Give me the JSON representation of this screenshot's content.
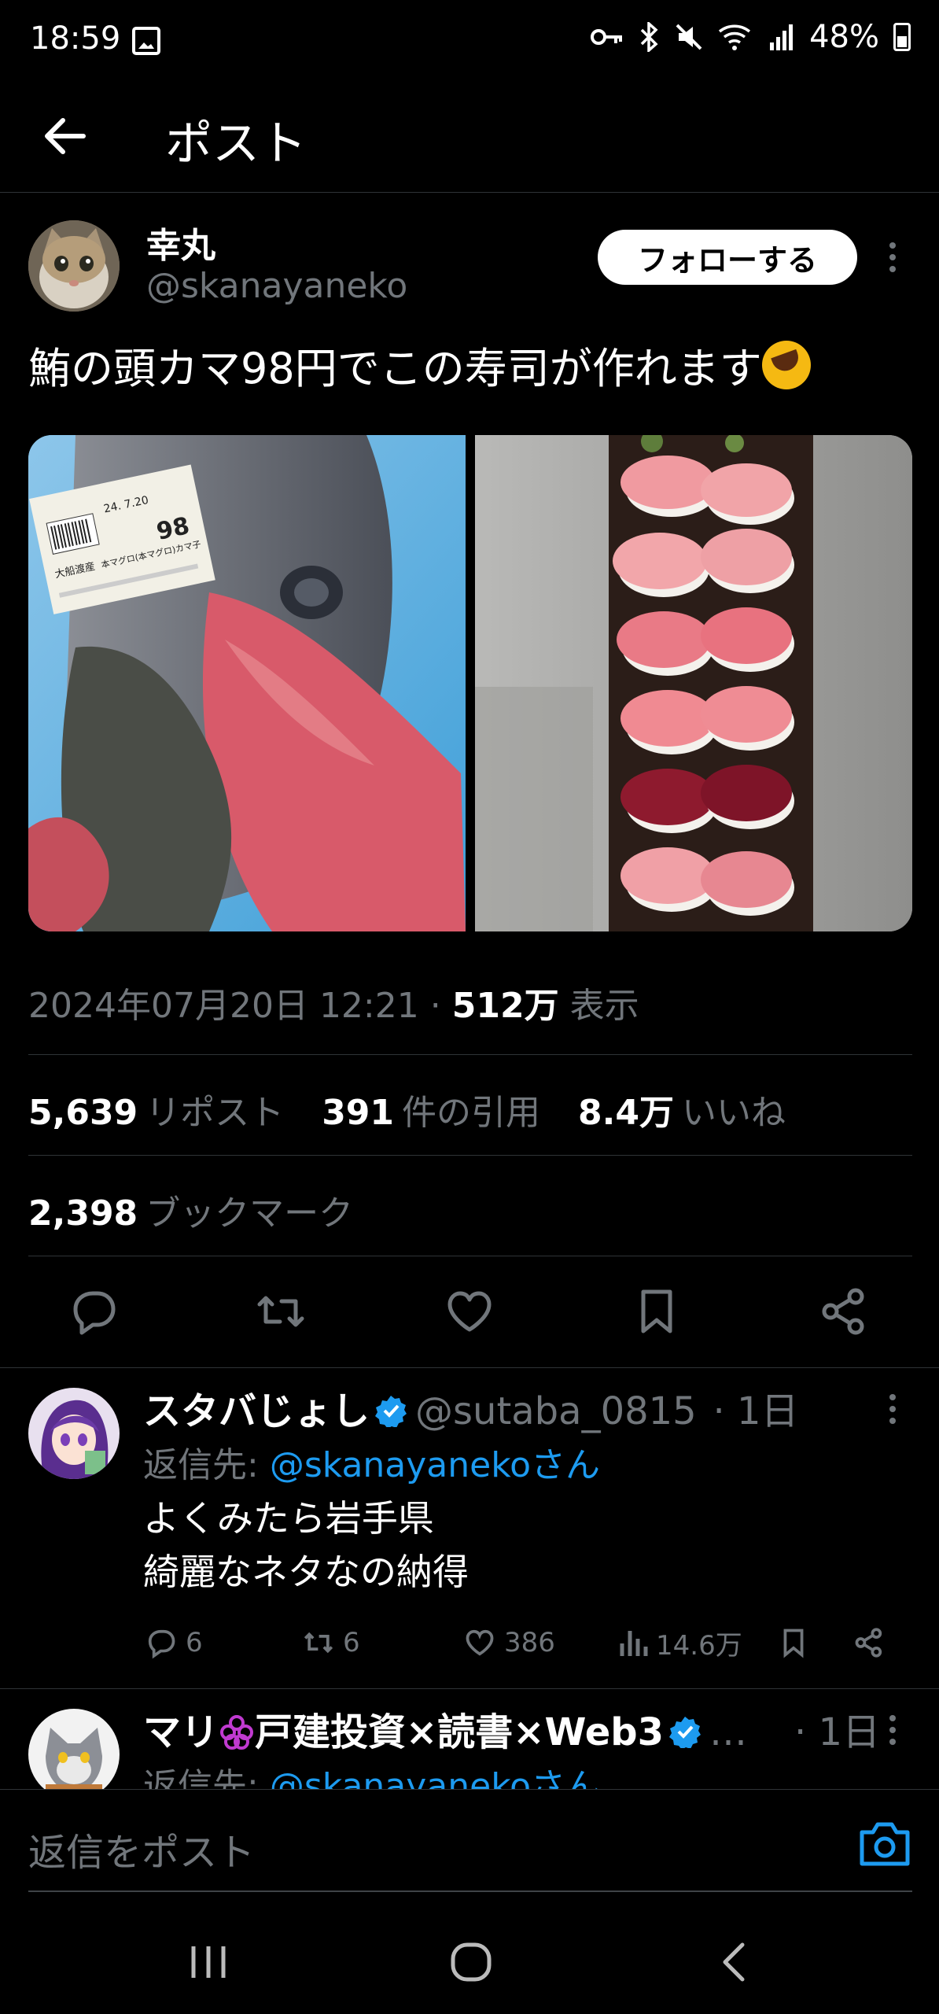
{
  "status_bar": {
    "time": "18:59",
    "battery": "48%"
  },
  "header": {
    "title": "ポスト"
  },
  "tweet": {
    "author_name": "幸丸",
    "author_handle": "@skanayaneko",
    "follow_label": "フォローする",
    "text": "鮪の頭カマ98円でこの寿司が作れます",
    "timestamp": "2024年07月20日 12:21",
    "separator": " · ",
    "views_count": "512万",
    "views_label": " 表示",
    "reposts_count": "5,639",
    "reposts_label": "リポスト",
    "quotes_count": "391",
    "quotes_label": "件の引用",
    "likes_count": "8.4万",
    "likes_label": "いいね",
    "bookmarks_count": "2,398",
    "bookmarks_label": "ブックマーク",
    "media": {
      "price_label": {
        "date_line": "24. 7.20",
        "price": "98",
        "origin": "大船渡産",
        "product": "本マグロ(本マグロ)カマ子"
      }
    }
  },
  "replies": [
    {
      "name": "スタバじょし",
      "handle": "@sutaba_0815",
      "time": "· 1日",
      "reply_to_prefix": "返信先: ",
      "reply_to_user": "@skanayanekoさん",
      "text_lines": [
        "よくみたら岩手県",
        "綺麗なネタなの納得"
      ],
      "replies": "6",
      "reposts": "6",
      "likes": "386",
      "views": "14.6万"
    },
    {
      "name": "マリ",
      "name_suffix": "戸建投資×読書×Web3",
      "ellipsis": "…",
      "time": "· 1日",
      "reply_to_prefix": "返信先: ",
      "reply_to_user": "@skanayanekoさん"
    }
  ],
  "compose": {
    "placeholder": "返信をポスト"
  },
  "colors": {
    "accent": "#1d9bf0",
    "muted": "#71767b",
    "background": "#000000",
    "divider": "#2f3336"
  },
  "icons": [
    "back-arrow-icon",
    "more-icon",
    "reply-icon",
    "repost-icon",
    "like-icon",
    "bookmark-icon",
    "share-icon",
    "views-icon",
    "verified-icon",
    "camera-icon",
    "recents-icon",
    "home-icon",
    "back-nav-icon"
  ]
}
